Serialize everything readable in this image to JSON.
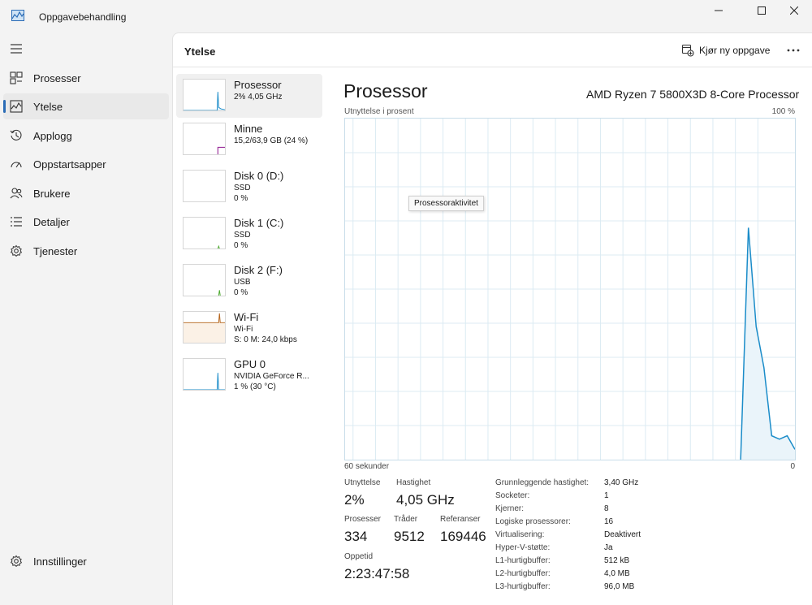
{
  "app": {
    "title": "Oppgavebehandling"
  },
  "nav": {
    "items": [
      {
        "label": "Prosesser",
        "icon": "processes-grid-icon"
      },
      {
        "label": "Ytelse",
        "icon": "performance-chart-icon",
        "selected": true
      },
      {
        "label": "Applogg",
        "icon": "history-icon"
      },
      {
        "label": "Oppstartsapper",
        "icon": "startup-speedometer-icon"
      },
      {
        "label": "Brukere",
        "icon": "users-icon"
      },
      {
        "label": "Detaljer",
        "icon": "details-list-icon"
      },
      {
        "label": "Tjenester",
        "icon": "services-gear-icon"
      }
    ],
    "settings_label": "Innstillinger"
  },
  "header": {
    "title": "Ytelse",
    "new_task_label": "Kjør ny oppgave"
  },
  "devices": [
    {
      "name": "Prosessor",
      "line1": "2% 4,05 GHz",
      "line2": "",
      "color": "#1a8cc9"
    },
    {
      "name": "Minne",
      "line1": "15,2/63,9 GB (24 %)",
      "line2": "",
      "color": "#9b2f9b"
    },
    {
      "name": "Disk 0 (D:)",
      "line1": "SSD",
      "line2": "0 %",
      "color": "#4daa2f"
    },
    {
      "name": "Disk 1 (C:)",
      "line1": "SSD",
      "line2": "0 %",
      "color": "#4daa2f"
    },
    {
      "name": "Disk 2 (F:)",
      "line1": "USB",
      "line2": "0 %",
      "color": "#4daa2f"
    },
    {
      "name": "Wi-Fi",
      "line1": "Wi-Fi",
      "line2": "S: 0 M: 24,0 kbps",
      "color": "#b5651d"
    },
    {
      "name": "GPU 0",
      "line1": "NVIDIA GeForce R...",
      "line2": "1 % (30 °C)",
      "color": "#1a8cc9"
    }
  ],
  "detail": {
    "title": "Prosessor",
    "cpu_name": "AMD Ryzen 7 5800X3D 8-Core Processor",
    "graph_label": "Utnyttelse i prosent",
    "graph_max": "100 %",
    "graph_x_left": "60 sekunder",
    "graph_x_right": "0",
    "tooltip": "Prosessoraktivitet",
    "graph_color": "#1a8cc9",
    "graph_samples": [
      0,
      0,
      0,
      0,
      0,
      0,
      0,
      0,
      0,
      0,
      0,
      0,
      0,
      0,
      0,
      0,
      0,
      0,
      0,
      0,
      0,
      0,
      0,
      0,
      0,
      0,
      0,
      0,
      0,
      0,
      0,
      0,
      0,
      0,
      0,
      0,
      0,
      0,
      0,
      0,
      0,
      0,
      0,
      0,
      0,
      0,
      0,
      0,
      0,
      0,
      0,
      0,
      68,
      39,
      27,
      7,
      6,
      7,
      3
    ],
    "stats": {
      "utilization_label": "Utnyttelse",
      "utilization_value": "2%",
      "speed_label": "Hastighet",
      "speed_value": "4,05 GHz",
      "processes_label": "Prosesser",
      "processes_value": "334",
      "threads_label": "Tråder",
      "threads_value": "9512",
      "handles_label": "Referanser",
      "handles_value": "169446",
      "uptime_label": "Oppetid",
      "uptime_value": "2:23:47:58"
    },
    "specs": [
      {
        "label": "Grunnleggende hastighet:",
        "value": "3,40 GHz"
      },
      {
        "label": "Socketer:",
        "value": "1"
      },
      {
        "label": "Kjerner:",
        "value": "8"
      },
      {
        "label": "Logiske prosessorer:",
        "value": "16"
      },
      {
        "label": "Virtualisering:",
        "value": "Deaktivert"
      },
      {
        "label": "Hyper-V-støtte:",
        "value": "Ja"
      },
      {
        "label": "L1-hurtigbuffer:",
        "value": "512 kB"
      },
      {
        "label": "L2-hurtigbuffer:",
        "value": "4,0 MB"
      },
      {
        "label": "L3-hurtigbuffer:",
        "value": "96,0 MB"
      }
    ]
  }
}
